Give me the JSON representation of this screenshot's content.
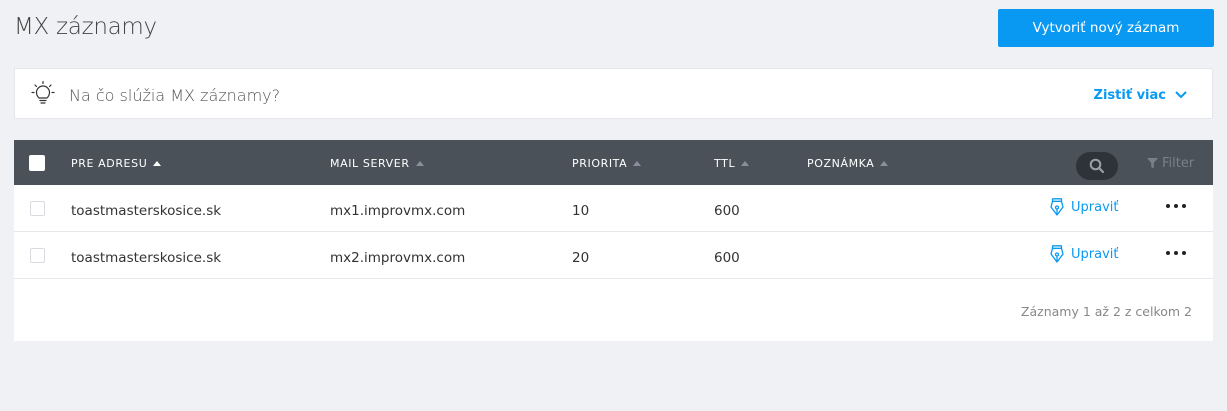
{
  "header": {
    "title": "MX záznamy",
    "create_button": "Vytvoriť nový záznam"
  },
  "info": {
    "text": "Na čo slúžia MX záznamy?",
    "more_link": "Zistiť viac",
    "icon": "lightbulb-icon"
  },
  "table": {
    "columns": {
      "pre_adresu": "PRE ADRESU",
      "mail_server": "MAIL SERVER",
      "priorita": "PRIORITA",
      "ttl": "TTL",
      "poznamka": "POZNÁMKA"
    },
    "sorted_column": "pre_adresu",
    "filter_label": "Filter",
    "rows": [
      {
        "address": "toastmasterskosice.sk",
        "mail_server": "mx1.improvmx.com",
        "priority": "10",
        "ttl": "600",
        "note": "",
        "edit_label": "Upraviť"
      },
      {
        "address": "toastmasterskosice.sk",
        "mail_server": "mx2.improvmx.com",
        "priority": "20",
        "ttl": "600",
        "note": "",
        "edit_label": "Upraviť"
      }
    ],
    "records_summary": "Záznamy 1 až 2 z celkom 2"
  },
  "colors": {
    "accent": "#0a99f2",
    "header_bg": "#4a5159",
    "page_bg": "#f0f1f4"
  }
}
